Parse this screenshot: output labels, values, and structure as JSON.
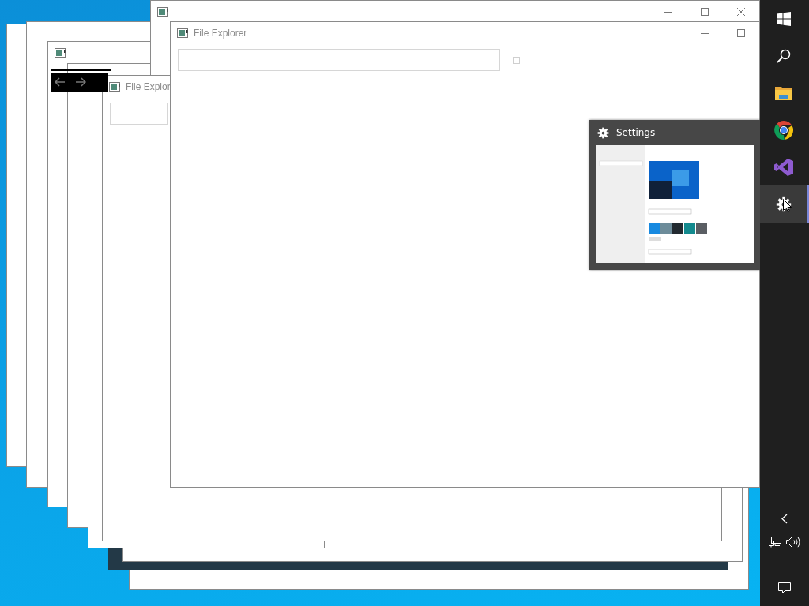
{
  "windows": [
    {
      "kind": "frame"
    },
    {
      "kind": "frame"
    },
    {
      "kind": "shadow"
    },
    {
      "kind": "frame"
    },
    {
      "kind": "frame"
    },
    {
      "kind": "nav"
    },
    {
      "kind": "frame"
    },
    {
      "kind": "frame"
    },
    {
      "kind": "icon",
      "controls": [
        {
          "kind": "minimize"
        },
        {
          "kind": "maximize"
        },
        {
          "kind": "close"
        }
      ]
    },
    {
      "kind": "titled",
      "title": "File Explor"
    },
    {
      "kind": "titled",
      "title": "File Explorer",
      "controls": [
        {
          "kind": "minimize"
        },
        {
          "kind": "maximize"
        }
      ]
    }
  ],
  "preview": {
    "title": "Settings"
  },
  "taskbar": {
    "apps": [
      {
        "kind": "start",
        "selected": false
      },
      {
        "kind": "search",
        "selected": false
      },
      {
        "kind": "folder",
        "selected": false
      },
      {
        "kind": "chrome",
        "selected": false
      },
      {
        "kind": "studio",
        "selected": false
      },
      {
        "kind": "settings",
        "selected": true
      }
    ],
    "tray": [
      {
        "kind": "chevron"
      },
      {
        "kind": "network"
      },
      {
        "kind": "volume"
      },
      {
        "kind": "notifications"
      }
    ]
  }
}
